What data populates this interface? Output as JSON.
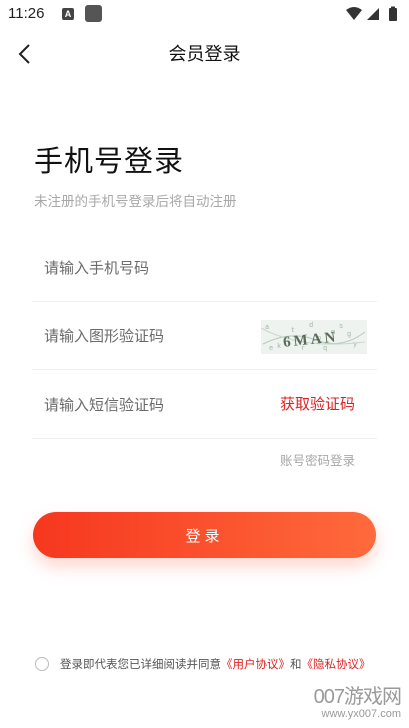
{
  "status_bar": {
    "time": "11:26",
    "app_letter": "A"
  },
  "header": {
    "title": "会员登录"
  },
  "main": {
    "heading": "手机号登录",
    "subheading": "未注册的手机号登录后将自动注册"
  },
  "form": {
    "phone_placeholder": "请输入手机号码",
    "captcha_placeholder": "请输入图形验证码",
    "captcha_text": "6MAN",
    "sms_placeholder": "请输入短信验证码",
    "sms_button": "获取验证码",
    "account_login": "账号密码登录",
    "login_button": "登录"
  },
  "agreement": {
    "prefix": "登录即代表您已详细阅读并同意",
    "user_agreement": "《用户协议》",
    "conjunction": "和",
    "privacy_policy": "《隐私协议》"
  },
  "watermark": {
    "line1": "007游戏网",
    "line2": "www.yx007.com"
  },
  "colors": {
    "accent": "#e02020",
    "button_start": "#f6371f",
    "button_end": "#ff6a3c"
  }
}
